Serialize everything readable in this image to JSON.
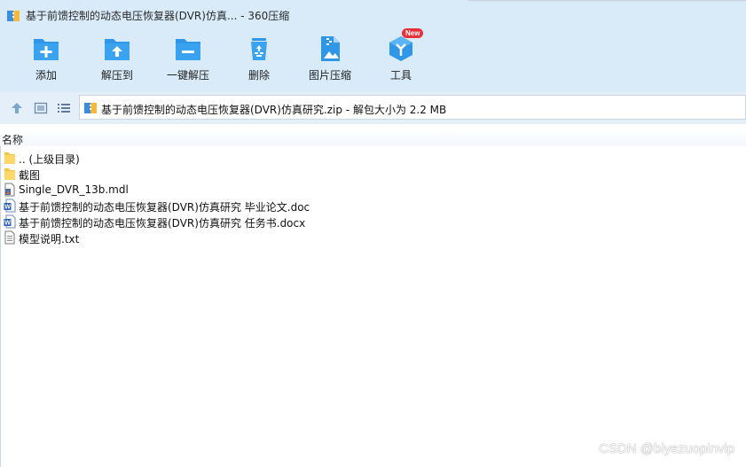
{
  "window": {
    "title": "基于前馈控制的动态电压恢复器(DVR)仿真... - 360压缩"
  },
  "toolbar": {
    "add_label": "添加",
    "extract_to_label": "解压到",
    "one_click_extract_label": "一键解压",
    "delete_label": "删除",
    "image_compress_label": "图片压缩",
    "tools_label": "工具",
    "tools_badge": "New"
  },
  "navbar": {
    "path": "基于前馈控制的动态电压恢复器(DVR)仿真研究.zip - 解包大小为 2.2 MB"
  },
  "list": {
    "column_name": "名称",
    "files": [
      {
        "name": ".. (上级目录)",
        "icon": "folder-icon"
      },
      {
        "name": "截图",
        "icon": "folder-icon"
      },
      {
        "name": "Single_DVR_13b.mdl",
        "icon": "mdl-file-icon"
      },
      {
        "name": "基于前馈控制的动态电压恢复器(DVR)仿真研究 毕业论文.doc",
        "icon": "word-doc-icon"
      },
      {
        "name": "基于前馈控制的动态电压恢复器(DVR)仿真研究 任务书.docx",
        "icon": "word-doc-icon"
      },
      {
        "name": "模型说明.txt",
        "icon": "text-file-icon"
      }
    ]
  },
  "watermark": "CSDN @biyezuopinvip",
  "colors": {
    "toolbar_bg": "#d9ebf9",
    "icon_blue": "#2f96e8",
    "folder_yellow": "#ffd766",
    "badge_red": "#e8303a"
  }
}
